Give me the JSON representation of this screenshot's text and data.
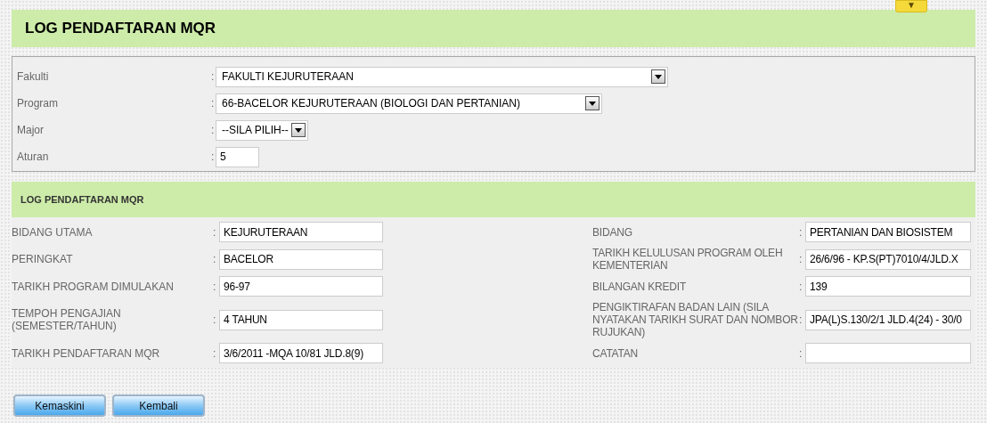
{
  "toggle": {
    "label": "▼"
  },
  "title": "LOG PENDAFTARAN MQR",
  "filters": [
    {
      "label": "Fakulti",
      "separator": ":",
      "kind": "select",
      "value": "FAKULTI KEJURUTERAAN"
    },
    {
      "label": "Program",
      "separator": ":",
      "kind": "select",
      "value": "66-BACELOR KEJURUTERAAN (BIOLOGI DAN PERTANIAN)"
    },
    {
      "label": "Major",
      "separator": ":",
      "kind": "select",
      "value": "--SILA PILIH--"
    },
    {
      "label": "Aturan",
      "separator": ":",
      "kind": "text",
      "value": "5"
    }
  ],
  "section": {
    "title": "LOG PENDAFTARAN MQR",
    "rows": [
      [
        {
          "label": "BIDANG UTAMA",
          "separator": ":",
          "value": "KEJURUTERAAN"
        },
        {
          "label": "BIDANG",
          "separator": ":",
          "value": "PERTANIAN DAN BIOSISTEM"
        }
      ],
      [
        {
          "label": "PERINGKAT",
          "separator": ":",
          "value": "BACELOR"
        },
        {
          "label": "TARIKH KELULUSAN PROGRAM OLEH KEMENTERIAN",
          "separator": ":",
          "value": "26/6/96 - KP.S(PT)7010/4/JLD.X"
        }
      ],
      [
        {
          "label": "TARIKH PROGRAM DIMULAKAN",
          "separator": ":",
          "value": "96-97"
        },
        {
          "label": "BILANGAN KREDIT",
          "separator": ":",
          "value": "139"
        }
      ],
      [
        {
          "label": "TEMPOH PENGAJIAN (SEMESTER/TAHUN)",
          "separator": ":",
          "value": "4 TAHUN"
        },
        {
          "label": "PENGIKTIRAFAN BADAN LAIN (SILA NYATAKAN TARIKH SURAT DAN NOMBOR RUJUKAN)",
          "separator": ":",
          "value": "JPA(L)S.130/2/1 JLD.4(24) - 30/0"
        }
      ],
      [
        {
          "label": "TARIKH PENDAFTARAN MQR",
          "separator": ":",
          "value": "3/6/2011 -MQA 10/81 JLD.8(9)"
        },
        {
          "label": "CATATAN",
          "separator": ":"
        }
      ]
    ]
  },
  "buttons": [
    "Kemaskini",
    "Kembali"
  ]
}
